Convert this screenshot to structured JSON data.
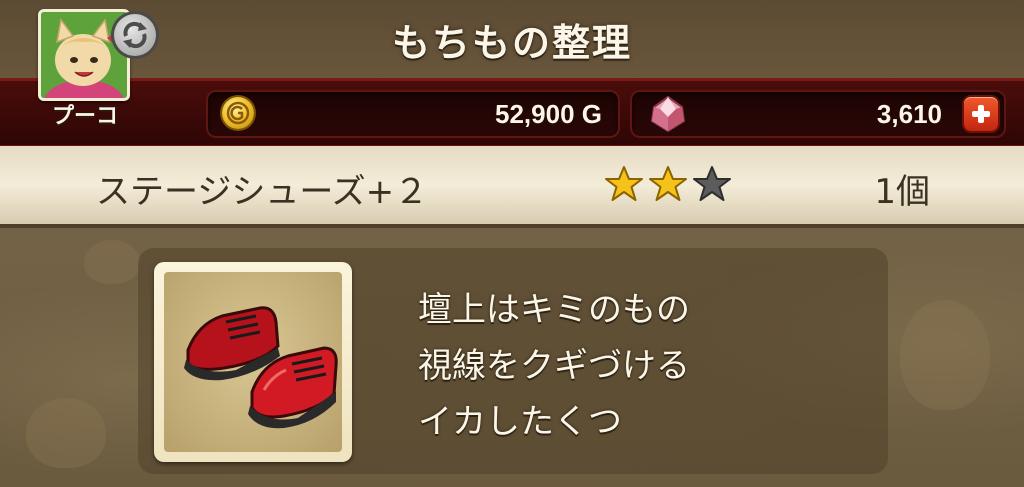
{
  "header": {
    "title": "もちもの整理"
  },
  "player": {
    "name": "プーコ"
  },
  "currency": {
    "gold": "52,900 G",
    "gems": "3,610"
  },
  "item": {
    "name": "ステージシューズ+２",
    "rating": 2,
    "rating_max": 3,
    "count": "1個",
    "description": [
      "壇上はキミのもの",
      "視線をクギづける",
      "イカしたくつ"
    ]
  },
  "colors": {
    "star_filled": "#f4c21a",
    "star_empty": "#5c5c5c",
    "currency_bar": "#3b0a08",
    "item_band": "#efe6d0"
  },
  "icons": {
    "gold": "gold-coin-icon",
    "gem": "gem-icon",
    "add": "plus-icon",
    "refresh": "refresh-icon",
    "item": "red-shoes-icon"
  }
}
